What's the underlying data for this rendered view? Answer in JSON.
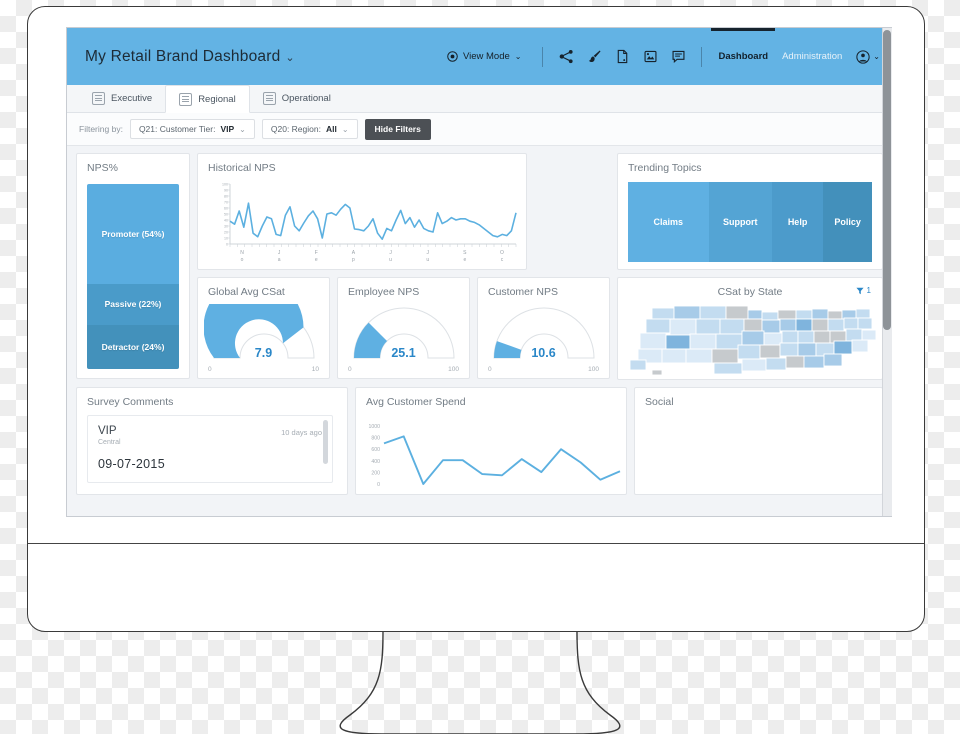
{
  "header": {
    "title": "My Retail Brand Dashboard",
    "title_caret": "⌄",
    "view_mode_label": "View Mode",
    "view_mode_caret": "⌄",
    "icons": [
      "share-icon",
      "paintbrush-icon",
      "page-icon",
      "image-icon",
      "comment-icon"
    ],
    "nav": [
      {
        "label": "Dashboard",
        "active": true
      },
      {
        "label": "Administration",
        "active": false
      }
    ],
    "avatar_caret": "⌄",
    "background_color": "#63b3e4"
  },
  "tabs": [
    {
      "label": "Executive",
      "active": false
    },
    {
      "label": "Regional",
      "active": true
    },
    {
      "label": "Operational",
      "active": false
    }
  ],
  "filters": {
    "label": "Filtering by:",
    "pills": [
      {
        "name": "Q21: Customer Tier:",
        "value": "VIP",
        "caret": "⌄"
      },
      {
        "name": "Q20: Region:",
        "value": "All",
        "caret": "⌄"
      }
    ],
    "hide_button": "Hide Filters"
  },
  "cards": {
    "nps": {
      "title": "NPS%",
      "segments": [
        {
          "label": "Promoter (54%)",
          "pct": 54,
          "color": "#5aade0"
        },
        {
          "label": "Passive (22%)",
          "pct": 22,
          "color": "#4a9bc9"
        },
        {
          "label": "Detractor (24%)",
          "pct": 24,
          "color": "#4391bb"
        }
      ]
    },
    "historical_nps": {
      "title": "Historical NPS"
    },
    "trending_topics": {
      "title": "Trending Topics",
      "topics": [
        {
          "label": "Claims",
          "weight": 33,
          "color": "#5fb0e2"
        },
        {
          "label": "Support",
          "weight": 26,
          "color": "#54a4d4"
        },
        {
          "label": "Help",
          "weight": 21,
          "color": "#4c9bcb"
        },
        {
          "label": "Policy",
          "weight": 20,
          "color": "#4390bb"
        }
      ]
    },
    "global_csat": {
      "title": "Global Avg CSat",
      "value": "7.9",
      "min": "0",
      "max": "10",
      "fill_pct": 79
    },
    "employee_nps": {
      "title": "Employee NPS",
      "value": "25.1",
      "min": "0",
      "max": "100",
      "fill_pct": 25
    },
    "customer_nps": {
      "title": "Customer NPS",
      "value": "10.6",
      "min": "0",
      "max": "100",
      "fill_pct": 11
    },
    "csat_by_state": {
      "title": "CSat by State",
      "filter_count": "1",
      "filter_icon": "funnel-icon"
    },
    "survey_comments": {
      "title": "Survey Comments",
      "comment": {
        "tier": "VIP",
        "region": "Central",
        "age": "10 days ago",
        "date": "09-07-2015"
      }
    },
    "avg_spend": {
      "title": "Avg Customer Spend"
    },
    "social": {
      "title": "Social"
    }
  },
  "chart_data": [
    {
      "type": "line",
      "title": "Historical NPS",
      "xlabel": "",
      "ylabel": "",
      "ylim": [
        0,
        100
      ],
      "y_ticks": [
        100,
        90,
        80,
        70,
        60,
        50,
        40,
        30,
        20,
        10,
        0
      ],
      "x_tick_labels": [
        "No",
        "Ja",
        "Fe",
        "Ap",
        "Ju",
        "Ju",
        "Se",
        "Oc"
      ],
      "grid": false,
      "series": [
        {
          "name": "NPS",
          "color": "#5cb0e0",
          "values": [
            38,
            33,
            55,
            28,
            68,
            18,
            12,
            30,
            45,
            42,
            16,
            14,
            48,
            62,
            30,
            22,
            35,
            47,
            55,
            42,
            10,
            50,
            52,
            48,
            58,
            66,
            60,
            25,
            24,
            22,
            30,
            42,
            18,
            8,
            26,
            22,
            40,
            56,
            34,
            44,
            28,
            40,
            26,
            22,
            20,
            52,
            34,
            38,
            44,
            40,
            42,
            42,
            38,
            36,
            32,
            26,
            20,
            14,
            12,
            16,
            14,
            22,
            52
          ]
        }
      ]
    },
    {
      "type": "gauge",
      "title": "Global Avg CSat",
      "value": 7.9,
      "min": 0,
      "max": 10
    },
    {
      "type": "gauge",
      "title": "Employee NPS",
      "value": 25.1,
      "min": 0,
      "max": 100
    },
    {
      "type": "gauge",
      "title": "Customer NPS",
      "value": 10.6,
      "min": 0,
      "max": 100
    },
    {
      "type": "bar",
      "title": "NPS%",
      "categories": [
        "Promoter",
        "Passive",
        "Detractor"
      ],
      "values": [
        54,
        22,
        24
      ],
      "ylabel": "%",
      "stacked": true
    },
    {
      "type": "bar",
      "title": "Trending Topics",
      "categories": [
        "Claims",
        "Support",
        "Help",
        "Policy"
      ],
      "values": [
        33,
        26,
        21,
        20
      ],
      "orientation": "horizontal-stacked"
    },
    {
      "type": "line",
      "title": "Avg Customer Spend",
      "ylim": [
        0,
        1000
      ],
      "y_ticks": [
        1000,
        800,
        600,
        400,
        200,
        0
      ],
      "grid": false,
      "series": [
        {
          "name": "Spend",
          "color": "#5cb0e0",
          "values": [
            700,
            820,
            0,
            410,
            410,
            170,
            150,
            430,
            205,
            600,
            370,
            75,
            220
          ]
        }
      ]
    },
    {
      "type": "heatmap",
      "title": "CSat by State",
      "subtype": "choropleth-us-states",
      "legend": "blue scale, grey = no data"
    }
  ]
}
